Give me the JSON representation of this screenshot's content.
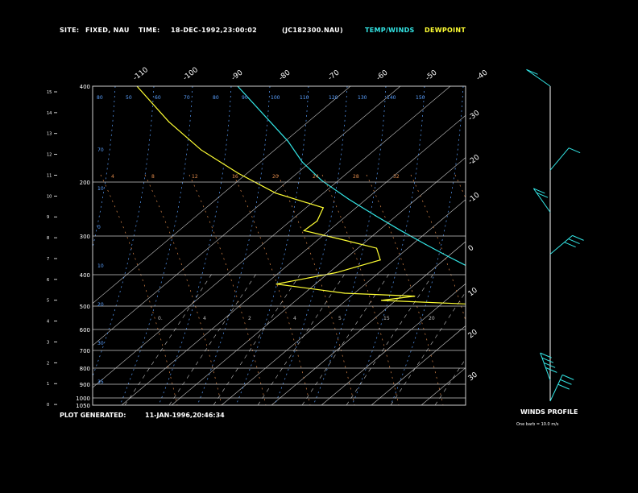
{
  "header": {
    "site_label": "SITE:",
    "site_value": "FIXED, NAU",
    "time_label": "TIME:",
    "time_value": "18-DEC-1992,23:00:02",
    "run_id": "(JC182300.NAU)",
    "legend_temp": "TEMP/WINDS",
    "legend_dew": "DEWPOINT"
  },
  "footer": {
    "generated_label": "PLOT GENERATED:",
    "generated_value": "11-JAN-1996,20:46:34"
  },
  "winds_panel": {
    "title": "WINDS PROFILE",
    "note": "One barb = 10.0 m/s"
  },
  "colors": {
    "temperature": "#33e6e6",
    "dewpoint": "#ffff33",
    "isotherm": "#c8c8c8",
    "isobar": "#c8c8c8",
    "dry_adiabat": "#5aa0ff",
    "moist_adiabat": "#e08a4a",
    "mixing_ratio": "#c0c0c0"
  },
  "chart_data": {
    "type": "line",
    "pressure_ticks": [
      "400",
      "200",
      "300",
      "400",
      "500",
      "600",
      "700",
      "800",
      "900",
      "1000",
      "1050"
    ],
    "height_ticks": [
      "15",
      "14",
      "13",
      "12",
      "11",
      "10",
      "9",
      "8",
      "7",
      "6",
      "5",
      "4",
      "3",
      "2",
      "1",
      "0"
    ],
    "top_isotherm_labels": [
      "-110",
      "-100",
      "-90",
      "-80",
      "-70",
      "-60",
      "-50",
      "-40"
    ],
    "right_isotherm_labels": [
      "-30",
      "-20",
      "-10",
      "0",
      "10",
      "20",
      "30"
    ],
    "dry_adiabat_labels": [
      "80",
      "50",
      "60",
      "70",
      "80",
      "90",
      "100",
      "110",
      "120",
      "130",
      "140",
      "150"
    ],
    "moist_adiabat_labels": [
      "4",
      "8",
      "12",
      "16",
      "20",
      "24",
      "28",
      "32"
    ],
    "mixing_labels": [
      "0.",
      "4",
      "2",
      "4",
      "5",
      "15",
      "20"
    ],
    "left_dry_labels": [
      "70",
      "10",
      "0",
      "10",
      "20",
      "30",
      "35"
    ],
    "series": [
      {
        "name": "TEMP/WINDS",
        "points": [
          [
            -54,
            100
          ],
          [
            -54.5,
            150
          ],
          [
            -56,
            175
          ],
          [
            -55.5,
            200
          ],
          [
            -53,
            230
          ],
          [
            -50,
            260
          ],
          [
            -47,
            290
          ],
          [
            -44,
            320
          ],
          [
            -41,
            350
          ],
          [
            -38,
            380
          ],
          [
            -35,
            410
          ],
          [
            -33,
            440
          ],
          [
            -31,
            470
          ],
          [
            -29,
            500
          ],
          [
            -27,
            530
          ],
          [
            -25,
            560
          ],
          [
            -23,
            590
          ],
          [
            -21,
            620
          ],
          [
            -19,
            650
          ],
          [
            -17,
            680
          ],
          [
            -15,
            710
          ],
          [
            -13,
            740
          ],
          [
            -11,
            770
          ],
          [
            -9,
            800
          ],
          [
            -7,
            830
          ],
          [
            -5,
            860
          ],
          [
            -3,
            890
          ],
          [
            -1,
            920
          ],
          [
            0.5,
            950
          ],
          [
            2,
            980
          ],
          [
            3,
            1000
          ],
          [
            4.5,
            1030
          ]
        ]
      },
      {
        "name": "DEWPOINT",
        "points": [
          [
            -81,
            100
          ],
          [
            -81.5,
            130
          ],
          [
            -80,
            160
          ],
          [
            -76,
            190
          ],
          [
            -71,
            220
          ],
          [
            -62,
            245
          ],
          [
            -67,
            270
          ],
          [
            -73,
            290
          ],
          [
            -65,
            310
          ],
          [
            -58,
            330
          ],
          [
            -60,
            360
          ],
          [
            -75,
            395
          ],
          [
            -94,
            430
          ],
          [
            -78,
            460
          ],
          [
            -60,
            470
          ],
          [
            -70,
            485
          ],
          [
            -45,
            500
          ],
          [
            -30,
            520
          ],
          [
            -31,
            545
          ],
          [
            -27,
            570
          ],
          [
            -31,
            600
          ],
          [
            -24,
            640
          ],
          [
            -19,
            700
          ],
          [
            -23,
            770
          ],
          [
            -15,
            800
          ],
          [
            -9,
            880
          ],
          [
            -12,
            930
          ],
          [
            -6,
            980
          ],
          [
            -3,
            1030
          ]
        ]
      }
    ],
    "winds": [
      {
        "height_km": 15,
        "barbs": 1
      },
      {
        "height_km": 11,
        "barbs": 1
      },
      {
        "height_km": 9,
        "barbs": 2
      },
      {
        "height_km": 7,
        "barbs": 3
      },
      {
        "height_km": 1,
        "barbs": 4
      },
      {
        "height_km": 0,
        "barbs": 3
      }
    ]
  }
}
